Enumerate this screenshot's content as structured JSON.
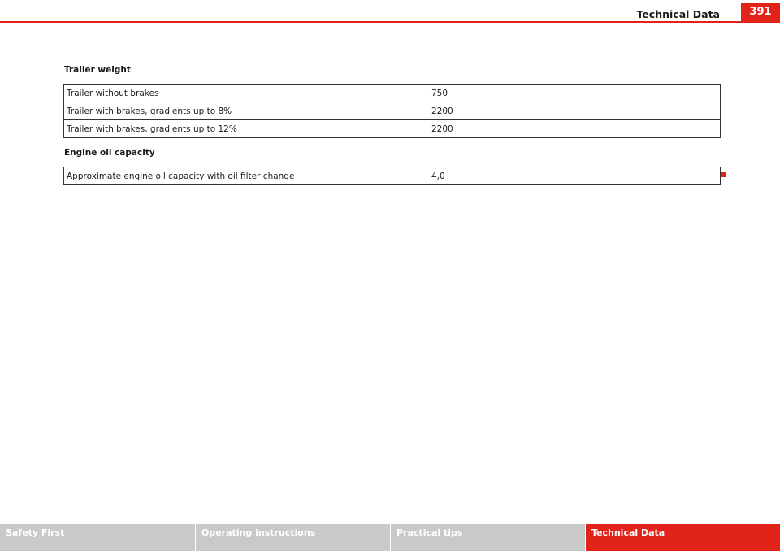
{
  "header": {
    "title": "Technical Data",
    "page_number": "391"
  },
  "sections": [
    {
      "heading": "Trailer weight",
      "rows": [
        {
          "label": "Trailer without brakes",
          "value": "750"
        },
        {
          "label": "Trailer with brakes, gradients up to 8%",
          "value": "2200"
        },
        {
          "label": "Trailer with brakes, gradients up to 12%",
          "value": "2200"
        }
      ]
    },
    {
      "heading": "Engine oil capacity",
      "rows": [
        {
          "label": "Approximate engine oil capacity with oil filter change",
          "value": "4,0"
        }
      ]
    }
  ],
  "footer": {
    "tabs": [
      {
        "label": "Safety First"
      },
      {
        "label": "Operating instructions"
      },
      {
        "label": "Practical tips"
      },
      {
        "label": "Technical Data"
      }
    ],
    "active_tab": "Technical Data"
  },
  "colors": {
    "accent": "#e2231a",
    "footer_tab": "#c8cac9"
  }
}
